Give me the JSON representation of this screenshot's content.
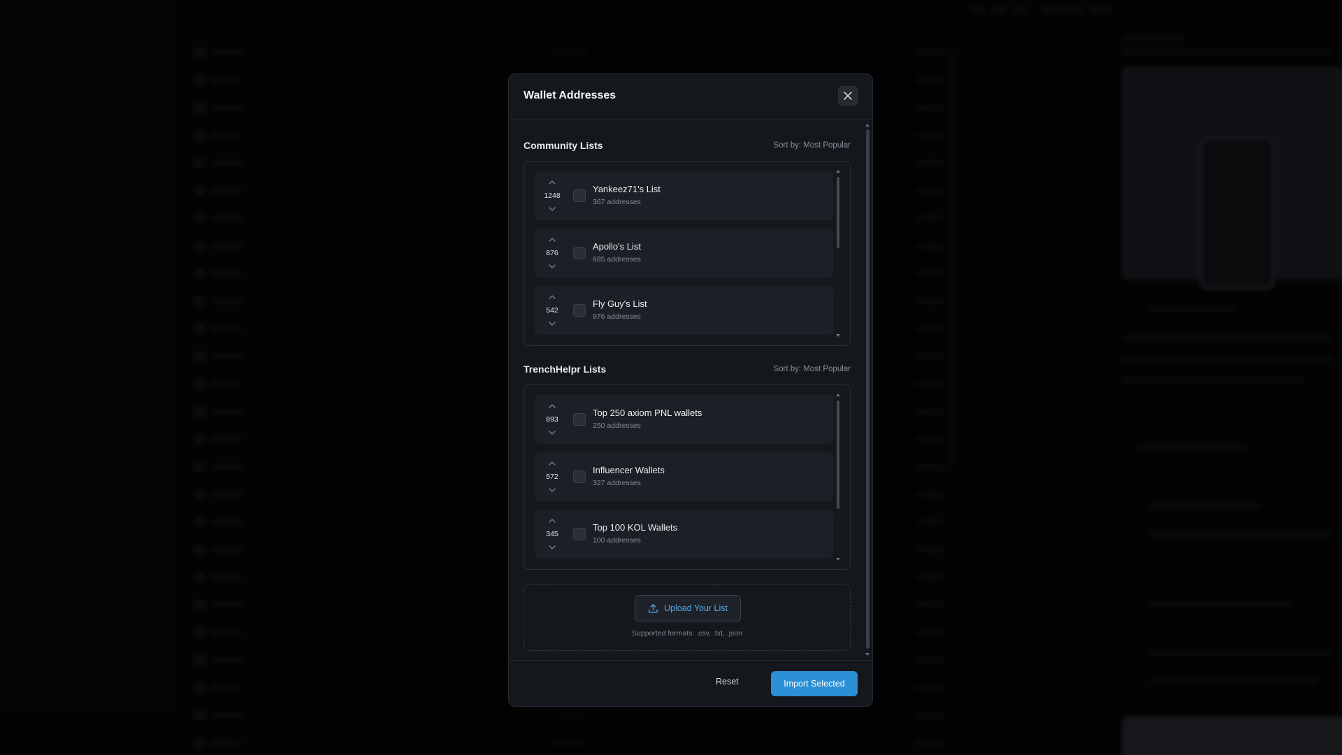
{
  "modal": {
    "title": "Wallet Addresses",
    "close_icon": "close-icon"
  },
  "community": {
    "title": "Community Lists",
    "sort_label": "Sort by: Most Popular",
    "items": [
      {
        "votes": "1248",
        "name": "Yankeez71's List",
        "sub": "367 addresses"
      },
      {
        "votes": "876",
        "name": "Apollo's List",
        "sub": "685 addresses"
      },
      {
        "votes": "542",
        "name": "Fly Guy's List",
        "sub": "976 addresses"
      }
    ]
  },
  "trench": {
    "title": "TrenchHelpr Lists",
    "sort_label": "Sort by: Most Popular",
    "items": [
      {
        "votes": "893",
        "name": "Top 250 axiom PNL wallets",
        "sub": "250 addresses"
      },
      {
        "votes": "572",
        "name": "Influencer Wallets",
        "sub": "327 addresses"
      },
      {
        "votes": "345",
        "name": "Top 100 KOL Wallets",
        "sub": "100 addresses"
      }
    ]
  },
  "upload": {
    "button_label": "Upload Your List",
    "hint": "Supported formats: .csv, .txt, .json",
    "icon": "upload-icon"
  },
  "footer": {
    "reset_label": "Reset",
    "import_label": "Import Selected"
  },
  "colors": {
    "accent": "#2b8fd6",
    "upload_text": "#4ea8e8",
    "modal_bg": "#14171c"
  }
}
